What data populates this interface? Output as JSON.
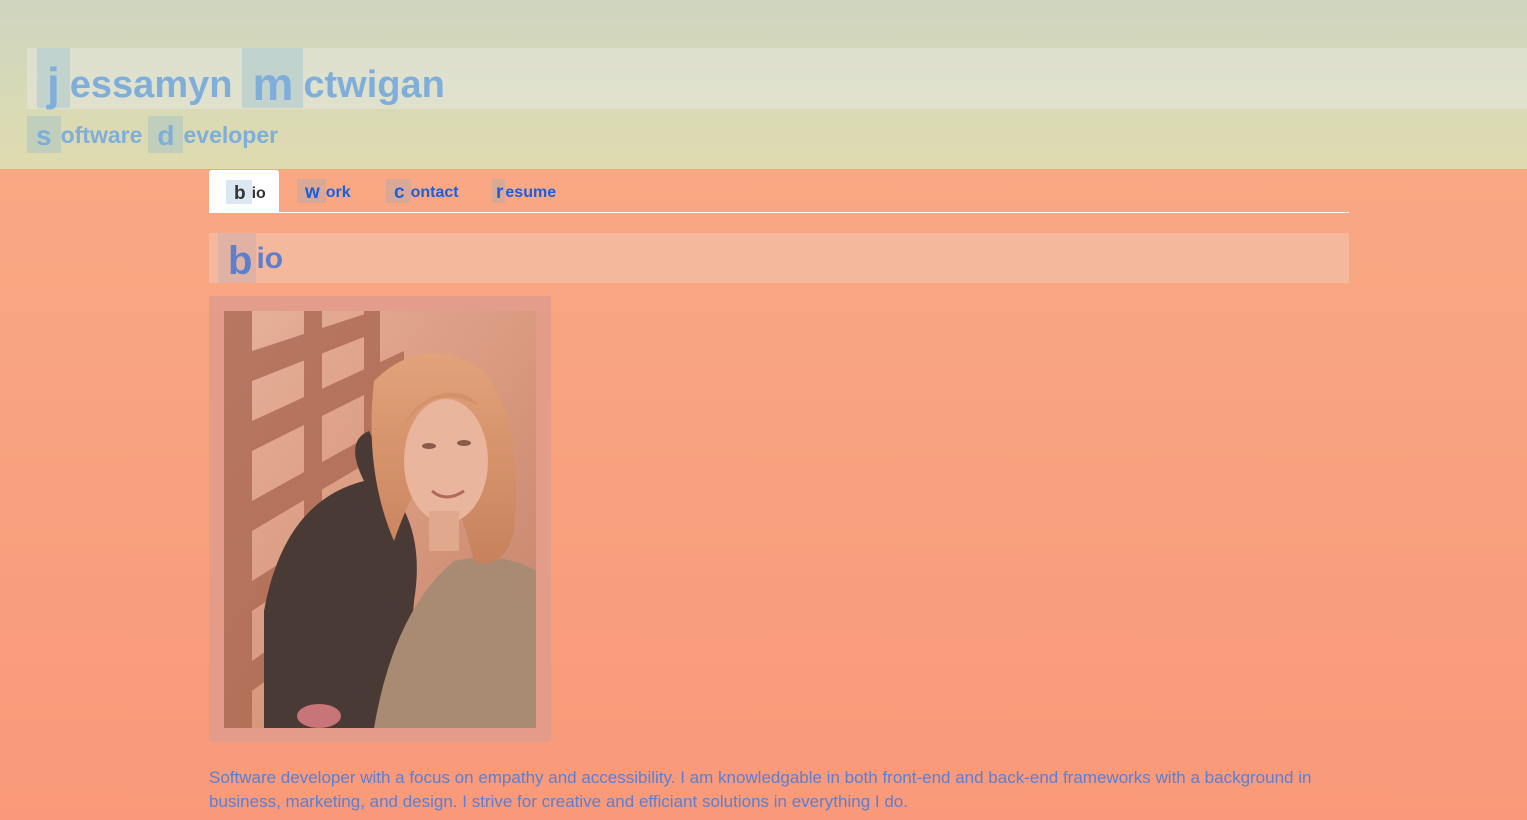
{
  "header": {
    "name_first_cap": "j",
    "name_first_rest": "essamyn",
    "name_last_cap": "m",
    "name_last_rest": "ctwigan",
    "subtitle_word1_cap": "s",
    "subtitle_word1_rest": "oftware",
    "subtitle_word2_cap": "d",
    "subtitle_word2_rest": "eveloper"
  },
  "nav": {
    "tabs": [
      {
        "cap": "b",
        "rest": "io",
        "active": true
      },
      {
        "cap": "w",
        "rest": "ork",
        "active": false
      },
      {
        "cap": "c",
        "rest": "ontact",
        "active": false
      },
      {
        "cap": "r",
        "rest": "esume",
        "active": false
      }
    ]
  },
  "section": {
    "heading_cap": "b",
    "heading_rest": "io"
  },
  "bio": {
    "text": "Software developer with a focus on empathy and accessibility. I am knowledgable in both front-end and back-end frameworks with a background in business, marketing, and design. I strive for creative and efficiant solutions in everything I do."
  },
  "colors": {
    "accent_text": "#7faedb",
    "link": "#1a5fe0",
    "body_text": "#5a7fd4",
    "bg_top": "#f9a883",
    "bg_bottom": "#f99979"
  },
  "icons": {
    "photo": "portrait-photo"
  }
}
